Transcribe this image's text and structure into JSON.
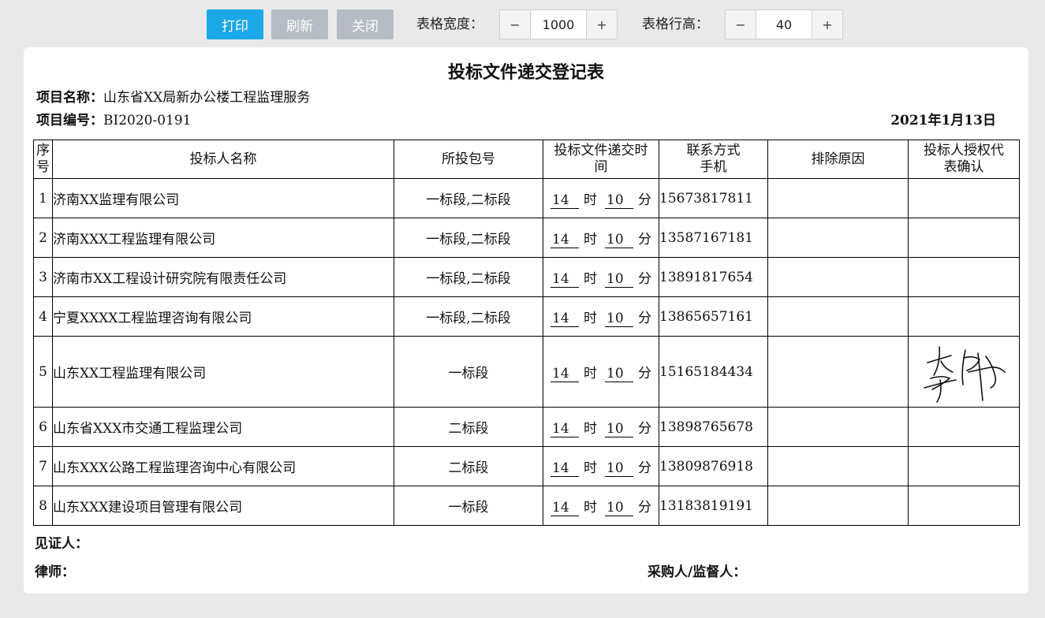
{
  "toolbar": {
    "print_label": "打印",
    "refresh_label": "刷新",
    "close_label": "关闭",
    "width_label": "表格宽度：",
    "width_value": "1000",
    "height_label": "表格行高：",
    "height_value": "40",
    "minus": "−",
    "plus": "+"
  },
  "colors": {
    "primary": "#1aa8e8",
    "disabled": "#b6bcc3",
    "background": "#e9e9e9"
  },
  "doc": {
    "title": "投标文件递交登记表",
    "project_name_label": "项目名称：",
    "project_name": "山东省XX局新办公楼工程监理服务",
    "project_no_label": "项目编号：",
    "project_no": "BI2020-0191",
    "date": "2021年1月13日"
  },
  "table": {
    "headers": {
      "no_1": "序",
      "no_2": "号",
      "bidder": "投标人名称",
      "package": "所投包号",
      "time_1": "投标文件递交时",
      "time_2": "间",
      "contact_1": "联系方式",
      "contact_2": "手机",
      "reason": "排除原因",
      "confirm_1": "投标人授权代",
      "confirm_2": "表确认"
    },
    "hour_unit": "时",
    "minute_unit": "分",
    "rows": [
      {
        "no": "1",
        "name": "济南XX监理有限公司",
        "package": "一标段,二标段",
        "hour": "14",
        "minute": "10",
        "phone": "15673817811",
        "reason": "",
        "signed": false
      },
      {
        "no": "2",
        "name": "济南XXX工程监理有限公司",
        "package": "一标段,二标段",
        "hour": "14",
        "minute": "10",
        "phone": "13587167181",
        "reason": "",
        "signed": false
      },
      {
        "no": "3",
        "name": "济南市XX工程设计研究院有限责任公司",
        "package": "一标段,二标段",
        "hour": "14",
        "minute": "10",
        "phone": "13891817654",
        "reason": "",
        "signed": false
      },
      {
        "no": "4",
        "name": "宁夏XXXX工程监理咨询有限公司",
        "package": "一标段,二标段",
        "hour": "14",
        "minute": "10",
        "phone": "13865657161",
        "reason": "",
        "signed": false
      },
      {
        "no": "5",
        "name": "山东XX工程监理有限公司",
        "package": "一标段",
        "hour": "14",
        "minute": "10",
        "phone": "15165184434",
        "reason": "",
        "signed": true
      },
      {
        "no": "6",
        "name": "山东省XXX市交通工程监理公司",
        "package": "二标段",
        "hour": "14",
        "minute": "10",
        "phone": "13898765678",
        "reason": "",
        "signed": false
      },
      {
        "no": "7",
        "name": "山东XXX公路工程监理咨询中心有限公司",
        "package": "二标段",
        "hour": "14",
        "minute": "10",
        "phone": "13809876918",
        "reason": "",
        "signed": false
      },
      {
        "no": "8",
        "name": "山东XXX建设项目管理有限公司",
        "package": "一标段",
        "hour": "14",
        "minute": "10",
        "phone": "13183819191",
        "reason": "",
        "signed": false
      }
    ]
  },
  "footer": {
    "witness_label": "见证人：",
    "lawyer_label": "律师：",
    "purchaser_label": "采购人/监督人："
  }
}
